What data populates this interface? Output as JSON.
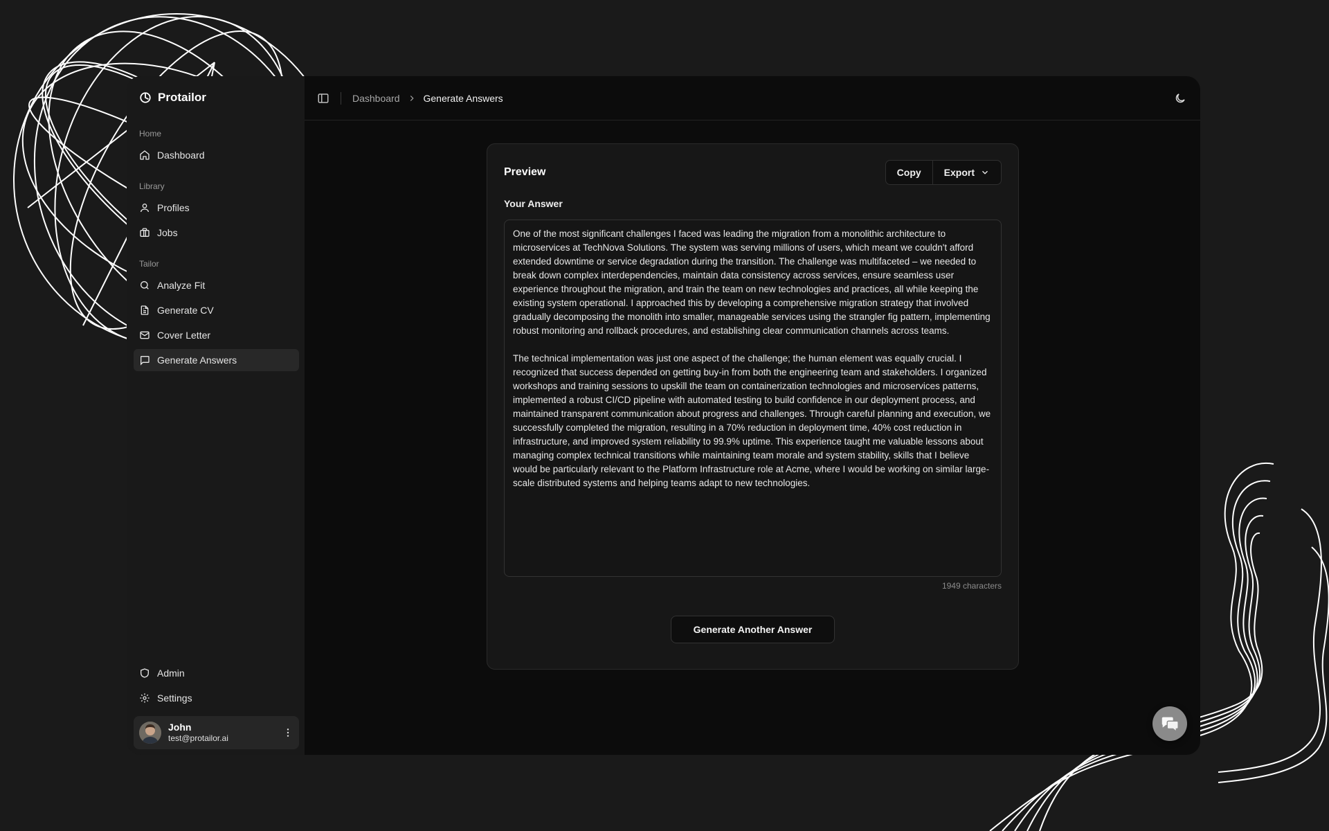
{
  "brand": {
    "name": "Protailor"
  },
  "sidebar": {
    "groups": [
      {
        "label": "Home",
        "items": [
          {
            "label": "Dashboard",
            "icon": "home-icon"
          }
        ]
      },
      {
        "label": "Library",
        "items": [
          {
            "label": "Profiles",
            "icon": "user-icon"
          },
          {
            "label": "Jobs",
            "icon": "briefcase-icon"
          }
        ]
      },
      {
        "label": "Tailor",
        "items": [
          {
            "label": "Analyze Fit",
            "icon": "search-icon"
          },
          {
            "label": "Generate CV",
            "icon": "file-icon"
          },
          {
            "label": "Cover Letter",
            "icon": "mail-icon"
          },
          {
            "label": "Generate Answers",
            "icon": "message-icon",
            "active": true
          }
        ]
      }
    ],
    "bottom": [
      {
        "label": "Admin",
        "icon": "shield-icon"
      },
      {
        "label": "Settings",
        "icon": "gear-icon"
      }
    ],
    "user": {
      "name": "John",
      "email": "test@protailor.ai"
    }
  },
  "breadcrumb": {
    "items": [
      "Dashboard",
      "Generate Answers"
    ]
  },
  "preview": {
    "title": "Preview",
    "copy_label": "Copy",
    "export_label": "Export",
    "answer_label": "Your Answer",
    "paragraphs": [
      "One of the most significant challenges I faced was leading the migration from a monolithic architecture to microservices at TechNova Solutions. The system was serving millions of users, which meant we couldn't afford extended downtime or service degradation during the transition. The challenge was multifaceted – we needed to break down complex interdependencies, maintain data consistency across services, ensure seamless user experience throughout the migration, and train the team on new technologies and practices, all while keeping the existing system operational. I approached this by developing a comprehensive migration strategy that involved gradually decomposing the monolith into smaller, manageable services using the strangler fig pattern, implementing robust monitoring and rollback procedures, and establishing clear communication channels across teams.",
      "The technical implementation was just one aspect of the challenge; the human element was equally crucial. I recognized that success depended on getting buy-in from both the engineering team and stakeholders. I organized workshops and training sessions to upskill the team on containerization technologies and microservices patterns, implemented a robust CI/CD pipeline with automated testing to build confidence in our deployment process, and maintained transparent communication about progress and challenges. Through careful planning and execution, we successfully completed the migration, resulting in a 70% reduction in deployment time, 40% cost reduction in infrastructure, and improved system reliability to 99.9% uptime. This experience taught me valuable lessons about managing complex technical transitions while maintaining team morale and system stability, skills that I believe would be particularly relevant to the Platform Infrastructure role at Acme, where I would be working on similar large-scale distributed systems and helping teams adapt to new technologies."
    ],
    "char_count": "1949 characters",
    "generate_label": "Generate Another Answer"
  },
  "colors": {
    "background": "#1a1a1a",
    "main": "#0c0c0c",
    "sidebar": "#191919",
    "card": "#171717"
  }
}
